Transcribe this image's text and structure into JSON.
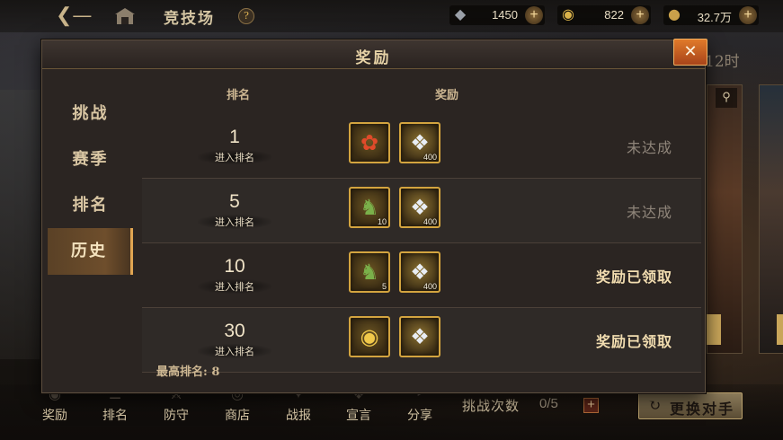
{
  "topbar": {
    "back_icon": "back-arrow-icon",
    "title": "竞技场",
    "help_glyph": "?",
    "currencies": [
      {
        "icon": "token-icon",
        "value": "1450"
      },
      {
        "icon": "gold-ingot-icon",
        "value": "822"
      },
      {
        "icon": "coin-icon",
        "value": "32.7万"
      }
    ]
  },
  "background": {
    "timer_fragment": "12时"
  },
  "modal": {
    "title": "奖励",
    "tabs": [
      {
        "label": "挑战",
        "active": false
      },
      {
        "label": "赛季",
        "active": false
      },
      {
        "label": "排名",
        "active": false
      },
      {
        "label": "历史",
        "active": true
      }
    ],
    "columns": {
      "rank": "排名",
      "reward": "奖励"
    },
    "rows": [
      {
        "rank": "1",
        "rank_sub": "进入排名",
        "items": [
          {
            "icon": "phoenix-mount-icon",
            "qty": ""
          },
          {
            "icon": "skill-book-icon",
            "qty": "400"
          }
        ],
        "status": "未达成",
        "claimed": false
      },
      {
        "rank": "5",
        "rank_sub": "进入排名",
        "items": [
          {
            "icon": "jade-qilin-icon",
            "qty": "10"
          },
          {
            "icon": "skill-book-icon",
            "qty": "400"
          }
        ],
        "status": "未达成",
        "claimed": false
      },
      {
        "rank": "10",
        "rank_sub": "进入排名",
        "items": [
          {
            "icon": "jade-qilin-icon",
            "qty": "5"
          },
          {
            "icon": "skill-book-icon",
            "qty": "400"
          }
        ],
        "status": "奖励已领取",
        "claimed": true
      },
      {
        "rank": "30",
        "rank_sub": "进入排名",
        "items": [
          {
            "icon": "gold-ingot-icon",
            "qty": ""
          },
          {
            "icon": "skill-book-icon",
            "qty": ""
          }
        ],
        "status": "奖励已领取",
        "claimed": true
      }
    ],
    "best_rank_label": "最高排名: 8"
  },
  "bottombar": {
    "nav": [
      {
        "label": "奖励",
        "icon": "reward-icon"
      },
      {
        "label": "排名",
        "icon": "ranking-icon"
      },
      {
        "label": "防守",
        "icon": "defense-icon"
      },
      {
        "label": "商店",
        "icon": "shop-icon"
      },
      {
        "label": "战报",
        "icon": "battle-report-icon"
      },
      {
        "label": "宣言",
        "icon": "declaration-icon"
      },
      {
        "label": "分享",
        "icon": "share-icon"
      }
    ],
    "attempts_label": "挑战次数",
    "attempts_value": "0/5",
    "attempts_plus": "+",
    "swap_label": "更换对手"
  },
  "colors": {
    "accent_gold": "#d3a43f",
    "close_orange": "#e07a2a",
    "claimed_text": "#f2ddb0",
    "pending_text": "#8f857a"
  }
}
